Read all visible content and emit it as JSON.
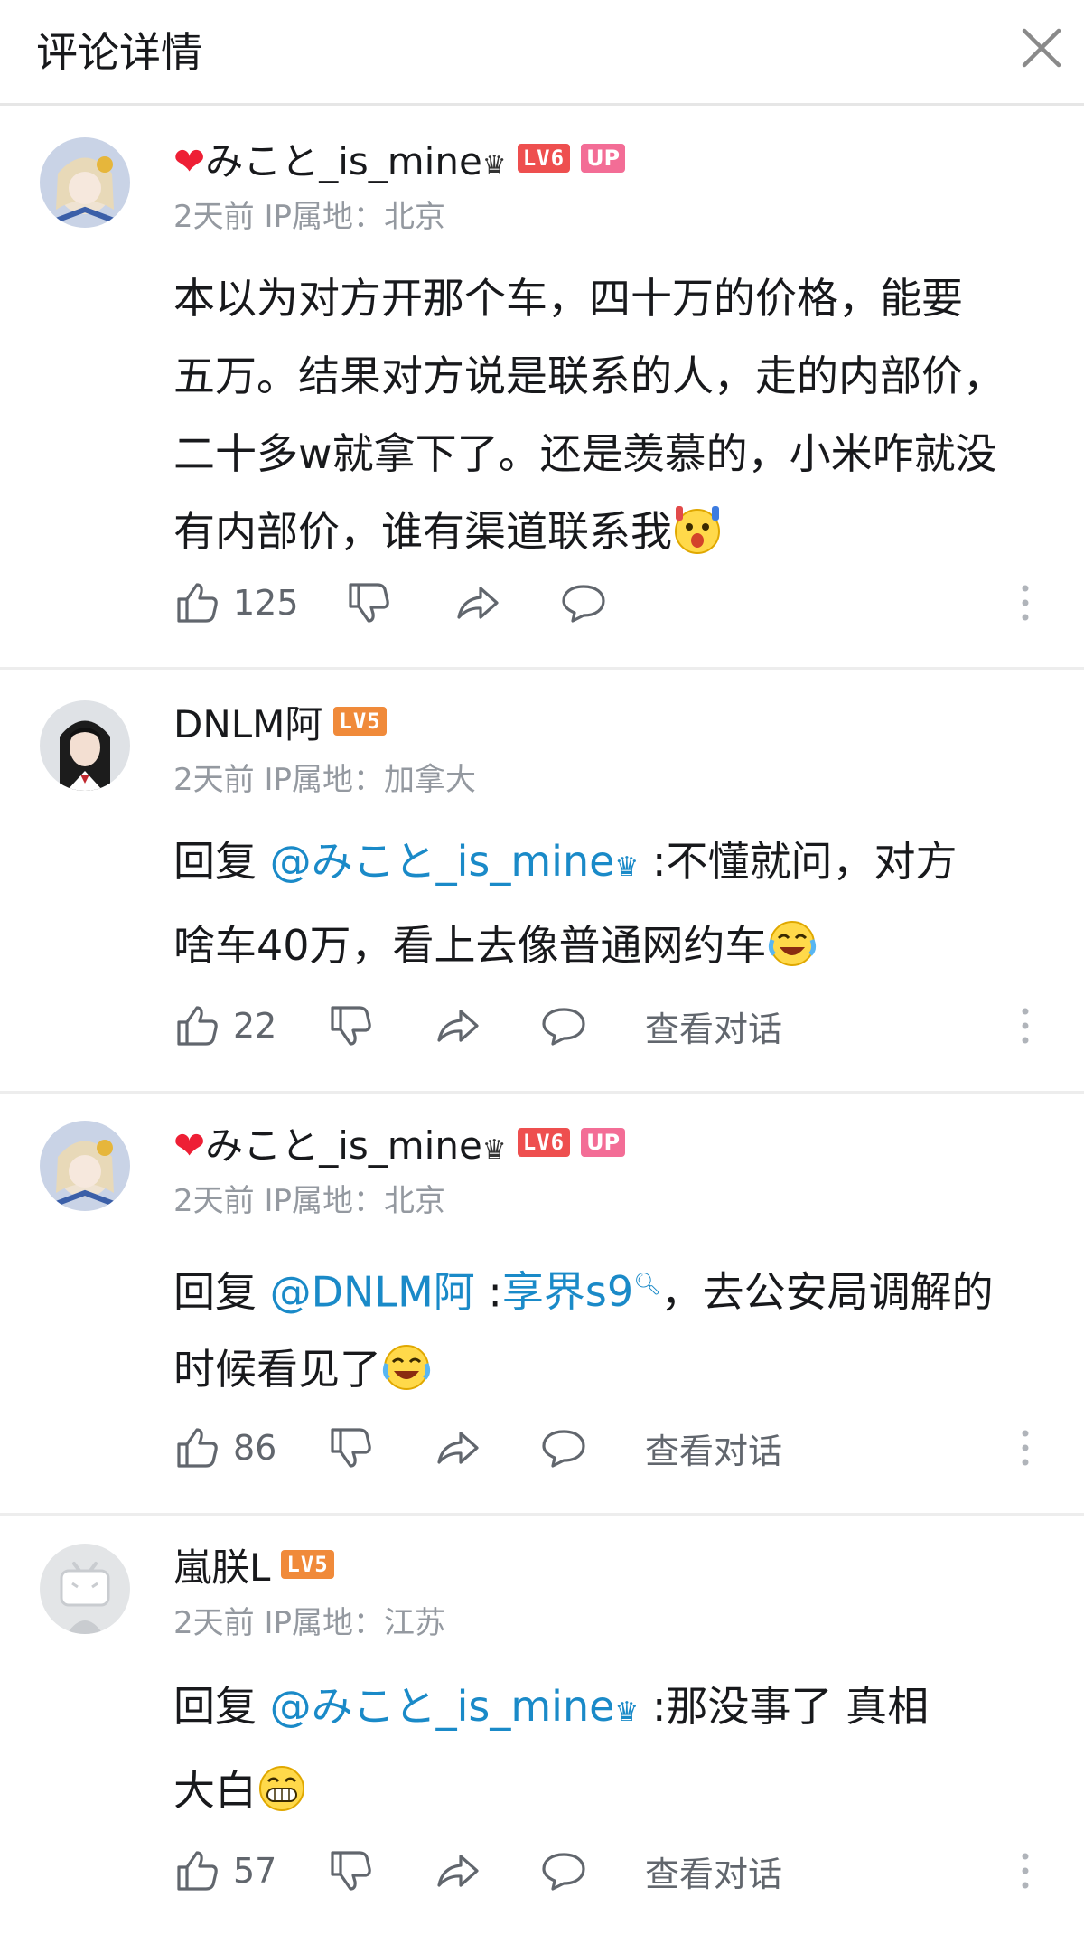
{
  "header": {
    "title": "评论详情"
  },
  "comments": [
    {
      "username": "みこと_is_mine",
      "level": "LV6",
      "up_badge": "UP",
      "meta": "2天前 IP属地：北京",
      "lines": [
        "本以为对方开那个车，四十万的价格，能要",
        "五万。结果对方说是联系的人，走的内部价，",
        "二十多w就拿下了。还是羡慕的，小米咋就没",
        "有内部价，谁有渠道联系我"
      ],
      "likes": "125"
    },
    {
      "username": "DNLM阿",
      "level": "LV5",
      "meta": "2天前 IP属地：加拿大",
      "reply_prefix": "回复 ",
      "mention": "@みこと_is_mine",
      "reply_text_1": " :不懂就问，对方",
      "reply_text_2": "啥车40万，看上去像普通网约车",
      "likes": "22",
      "view_conversation": "查看对话"
    },
    {
      "username": "みこと_is_mine",
      "level": "LV6",
      "up_badge": "UP",
      "meta": "2天前 IP属地：北京",
      "reply_prefix": "回复 ",
      "mention": "@DNLM阿",
      "reply_sep": " :",
      "search_link": "享界s9",
      "reply_text_1": "，去公安局调解的",
      "reply_text_2": "时候看见了",
      "likes": "86",
      "view_conversation": "查看对话"
    },
    {
      "username": "嵐朕L",
      "level": "LV5",
      "meta": "2天前 IP属地：江苏",
      "reply_prefix": "回复 ",
      "mention": "@みこと_is_mine",
      "reply_text_1": " :那没事了 真相",
      "reply_text_2": "大白",
      "likes": "57",
      "view_conversation": "查看对话"
    }
  ],
  "icons": {
    "like": "thumbs-up-icon",
    "dislike": "thumbs-down-icon",
    "share": "share-icon",
    "reply": "comment-bubble-icon",
    "more": "more-vertical-icon",
    "close": "close-icon"
  },
  "colors": {
    "mention": "#1a8ac8",
    "lv6": "#ee4f4f",
    "lv5": "#f08a3a",
    "up": "#f36d96",
    "heart": "#ee1f35"
  }
}
